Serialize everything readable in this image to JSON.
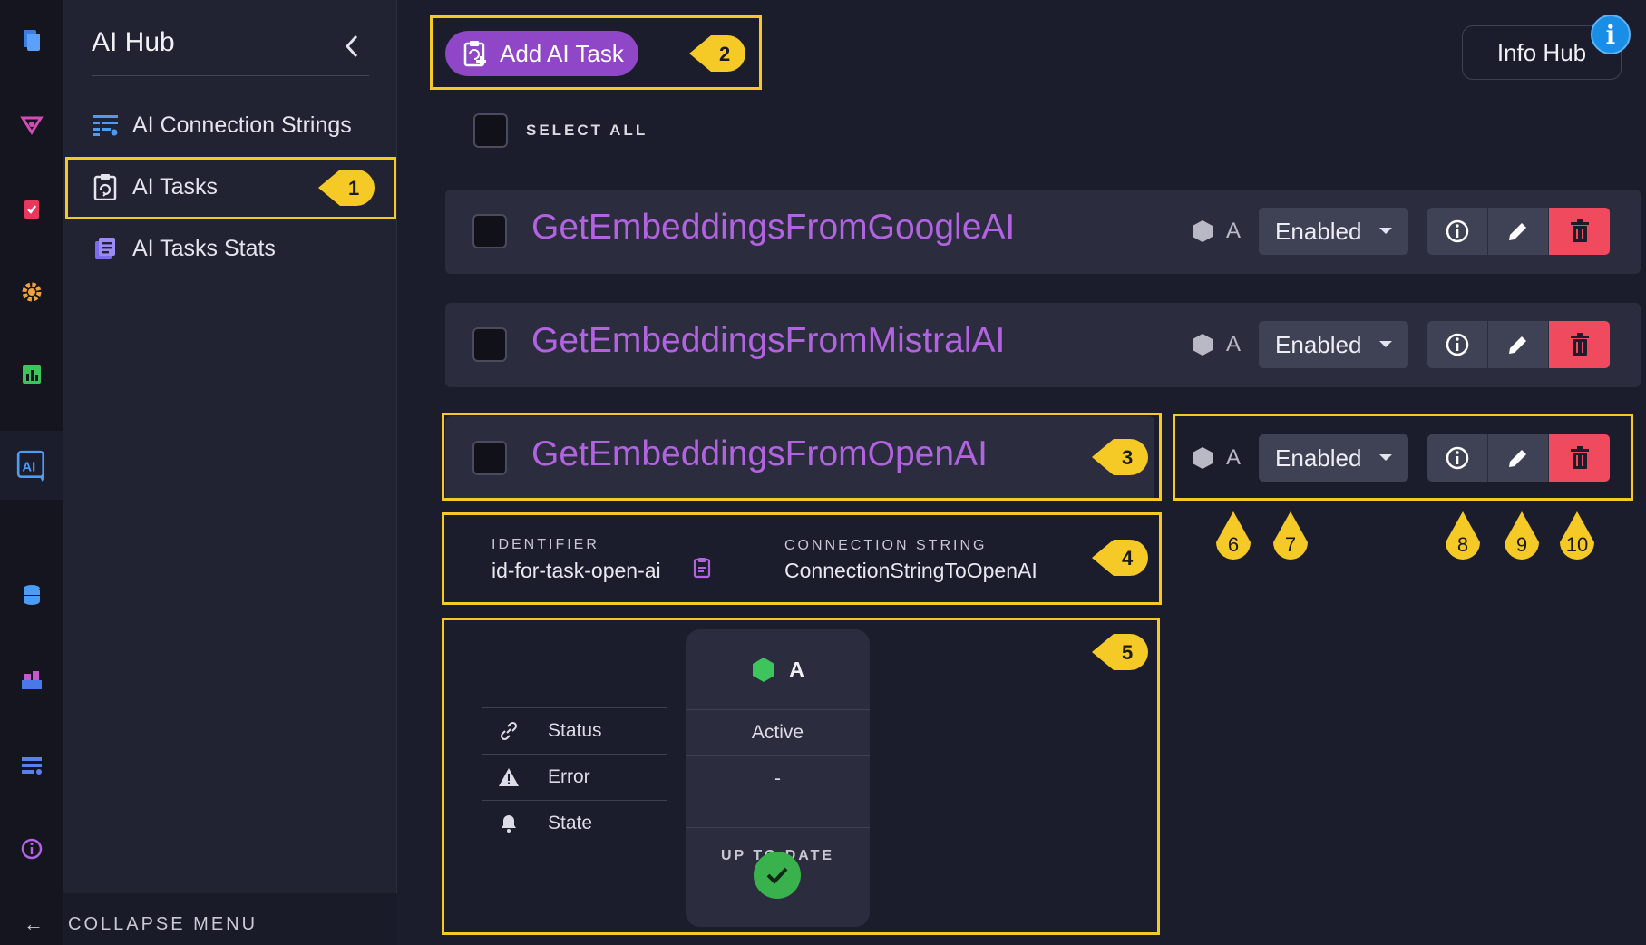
{
  "sidebar": {
    "title": "AI Hub",
    "items": [
      {
        "label": "AI Connection Strings",
        "icon": "connection-strings-icon"
      },
      {
        "label": "AI Tasks",
        "icon": "clipboard-icon"
      },
      {
        "label": "AI Tasks Stats",
        "icon": "stats-list-icon"
      }
    ],
    "collapse_label": "COLLAPSE MENU"
  },
  "toolbar": {
    "add_task_label": "Add AI Task",
    "info_hub_label": "Info Hub",
    "select_all_label": "SELECT ALL"
  },
  "tasks": [
    {
      "name": "GetEmbeddingsFromGoogleAI",
      "node": "A",
      "state": "Enabled"
    },
    {
      "name": "GetEmbeddingsFromMistralAI",
      "node": "A",
      "state": "Enabled"
    },
    {
      "name": "GetEmbeddingsFromOpenAI",
      "node": "A",
      "state": "Enabled"
    }
  ],
  "details": {
    "identifier_label": "IDENTIFIER",
    "identifier_value": "id-for-task-open-ai",
    "connection_label": "CONNECTION STRING",
    "connection_value": "ConnectionStringToOpenAI"
  },
  "node_status": {
    "node": "A",
    "rows": [
      {
        "label": "Status",
        "value": "Active"
      },
      {
        "label": "Error",
        "value": "-"
      },
      {
        "label": "State",
        "value": "UP TO DATE"
      }
    ]
  },
  "annotations": [
    "1",
    "2",
    "3",
    "4",
    "5",
    "6",
    "7",
    "8",
    "9",
    "10"
  ],
  "colors": {
    "accent": "#8f47c8",
    "task_name": "#b163e0",
    "delete": "#f04a5f",
    "highlight": "#f5c926",
    "node_ok": "#39b24d"
  }
}
